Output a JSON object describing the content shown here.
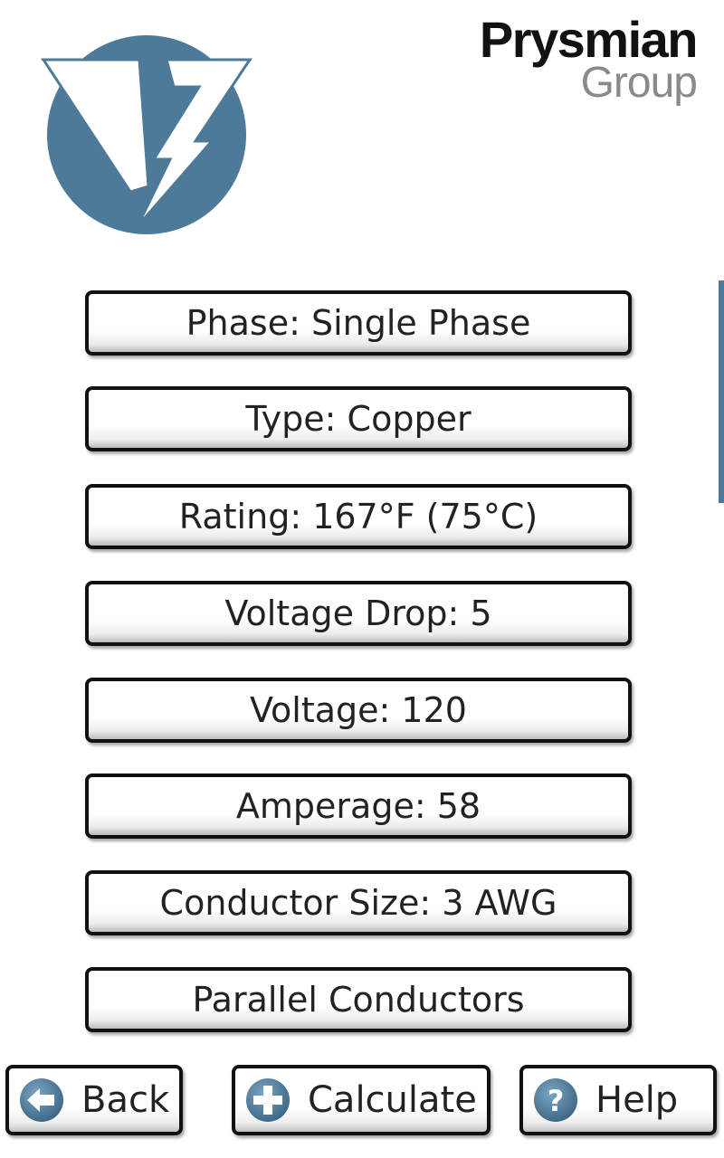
{
  "brand": {
    "name": "Prysmian",
    "sub": "Group"
  },
  "logo": {
    "icon": "lightning-v-logo",
    "color": "#4d7a98"
  },
  "options": [
    {
      "label": "Phase: Single Phase"
    },
    {
      "label": "Type: Copper"
    },
    {
      "label": "Rating: 167°F (75°C)"
    },
    {
      "label": "Voltage Drop: 5"
    },
    {
      "label": "Voltage: 120"
    },
    {
      "label": "Amperage: 58"
    },
    {
      "label": "Conductor Size: 3 AWG"
    },
    {
      "label": "Parallel Conductors"
    }
  ],
  "nav": {
    "back": {
      "label": "Back",
      "icon": "arrow-left-icon"
    },
    "calculate": {
      "label": "Calculate",
      "icon": "plus-icon"
    },
    "help": {
      "label": "Help",
      "icon": "question-icon"
    }
  }
}
